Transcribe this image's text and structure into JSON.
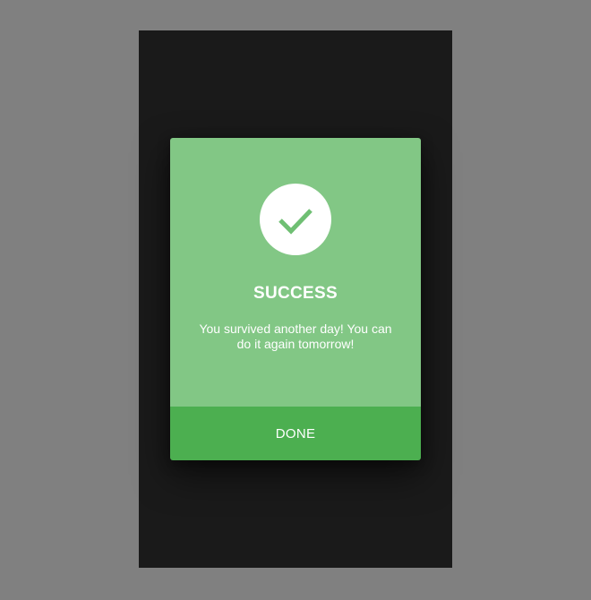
{
  "dialog": {
    "icon": "checkmark-icon",
    "title": "SUCCESS",
    "message": "You survived another day! You can do it again tomorrow!",
    "button_label": "DONE"
  },
  "colors": {
    "page_background": "#808080",
    "screen_background": "#1a1a1a",
    "dialog_body": "#82c785",
    "button_background": "#4caf50",
    "check_color": "#6fbf73",
    "text": "#ffffff"
  }
}
